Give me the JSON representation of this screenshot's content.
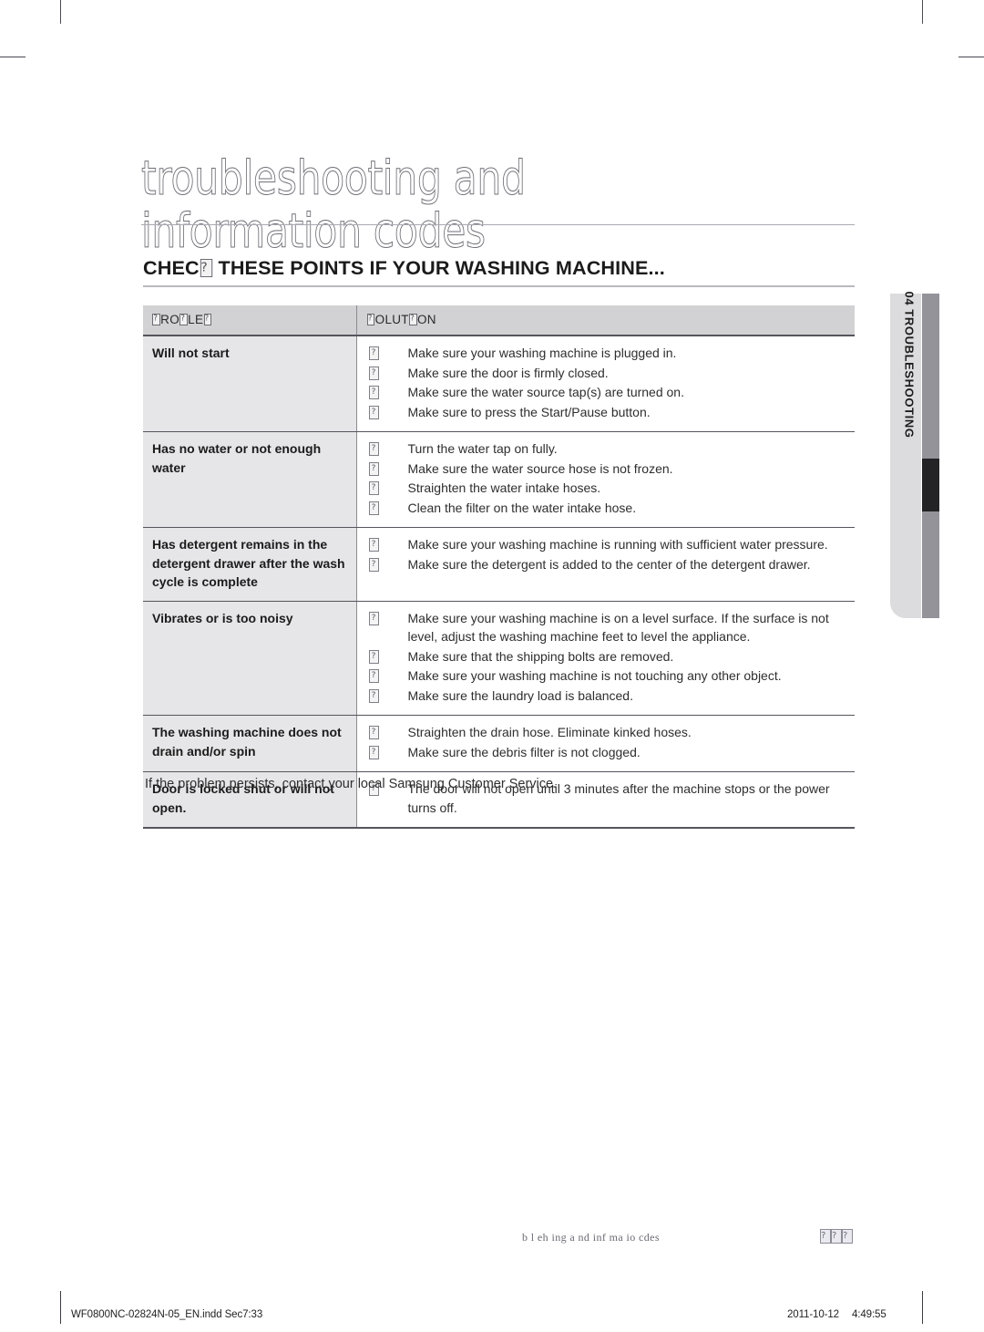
{
  "page_title": {
    "line1": "troubleshooting and",
    "line2": "information codes"
  },
  "section_heading": {
    "prefix": "CHEC",
    "suffix": " THESE POINTS IF YOUR WASHING MACHINE..."
  },
  "table": {
    "headers": {
      "problem": {
        "p1": "",
        "p2": "RO",
        "p3": "",
        "p4": "LE",
        "p5": "",
        "raw": "PROBLEM (rendered with missing glyphs: ?RO?LE?)"
      },
      "solution": {
        "s1": "",
        "s2": "OLUT",
        "s3": "",
        "s4": "ON",
        "raw": "SOLUTION (rendered with missing glyphs: ?OLUT?ON)"
      }
    },
    "rows": [
      {
        "problem": "Will not start",
        "solutions": [
          "Make sure your washing machine is plugged in.",
          "Make sure the door is firmly closed.",
          "Make sure the water source tap(s) are turned on.",
          "Make sure to press the Start/Pause button."
        ]
      },
      {
        "problem": "Has no water or not enough water",
        "solutions": [
          "Turn the water tap on fully.",
          "Make sure the water source hose is not frozen.",
          "Straighten the water intake hoses.",
          "Clean the filter on the water intake hose."
        ]
      },
      {
        "problem": "Has detergent remains in the detergent drawer after the wash cycle is complete",
        "solutions": [
          "Make sure your washing machine is running with sufficient water pressure.",
          "Make sure the detergent is added to the center of the detergent drawer."
        ]
      },
      {
        "problem": "Vibrates or is too noisy",
        "solutions": [
          "Make sure your washing machine is on a level surface. If the surface is not level, adjust the washing machine feet to level the appliance.",
          "Make sure that the shipping bolts are removed.",
          "Make sure your washing machine is not touching any other object.",
          "Make sure the laundry load is balanced."
        ]
      },
      {
        "problem": "The washing machine does not drain and/or spin",
        "solutions": [
          "Straighten the drain hose. Eliminate kinked hoses.",
          "Make sure the debris filter is not clogged."
        ]
      },
      {
        "problem": "Door is locked shut or will not open.",
        "solutions": [
          "The door will not open until 3 minutes after the machine stops or the power turns off."
        ]
      }
    ]
  },
  "closing_note": "If the problem persists, contact your local Samsung Customer Service.",
  "side_tab": {
    "label": "04 TROUBLESHOOTING"
  },
  "running_footer": {
    "text": "b l eh ing  a nd inf ma io cdes"
  },
  "print_info": {
    "file": "WF0800NC-02824N-05_EN.indd   Sec7:33",
    "date": "2011-10-12",
    "time": "4:49:55"
  },
  "colors": {
    "header_row_bg": "#d2d2d4",
    "problem_cell_bg": "#e6e6e8",
    "rule": "#55555c",
    "side_tab_panel": "#dcdcde",
    "side_tab_bar": "#939399",
    "side_tab_marker": "#232326"
  }
}
